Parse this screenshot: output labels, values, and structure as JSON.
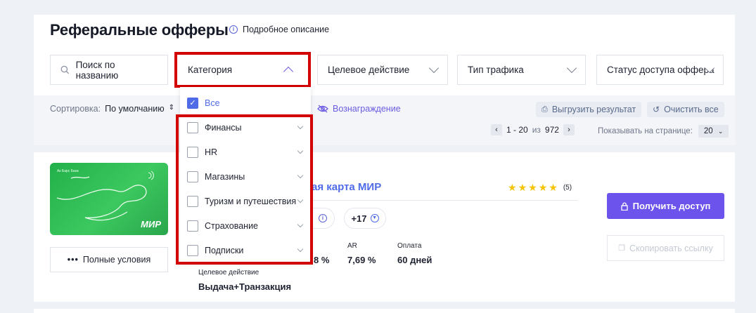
{
  "header": {
    "title": "Реферальные офферы",
    "info_link": "Подробное описание"
  },
  "filters": {
    "search_placeholder": "Поиск по названию",
    "category": "Категория",
    "target_action": "Целевое действие",
    "traffic_type": "Тип трафика",
    "access_status": "Статус доступа оффера"
  },
  "category_dropdown": {
    "all_label": "Все",
    "items": [
      "Финансы",
      "HR",
      "Магазины",
      "Туризм и путешествия",
      "Страхование",
      "Подписки"
    ]
  },
  "toolbar": {
    "sort_label": "Сортировка:",
    "sort_value": "По умолчанию",
    "reward_label": "Вознаграждение",
    "export_label": "Выгрузить результат",
    "clear_label": "Очистить все"
  },
  "pagination": {
    "range": "1 - 20",
    "of_word": "из",
    "total": "972",
    "per_page_label": "Показывать на странице:",
    "per_page_value": "20"
  },
  "offer": {
    "card_bank": "Ак Барс Банк",
    "card_brand": "МИР",
    "title": "ая карта МИР",
    "rating_count": "(5)",
    "tag_plus": "+17",
    "stat_cr_partial": "8 %",
    "ar_label": "AR",
    "ar_value": "7,69 %",
    "payment_label": "Оплата",
    "payment_value": "60 дней",
    "target_action_label": "Целевое действие",
    "target_action_value": "Выдача+Транзакция",
    "full_terms_label": "Полные условия",
    "get_access_label": "Получить доступ",
    "copy_link_label": "Скопировать ссылку"
  },
  "colors": {
    "accent": "#6b53ec",
    "link": "#4f6be8",
    "highlight": "#d30000",
    "card_green": "#2fb552",
    "star": "#f5c400"
  }
}
